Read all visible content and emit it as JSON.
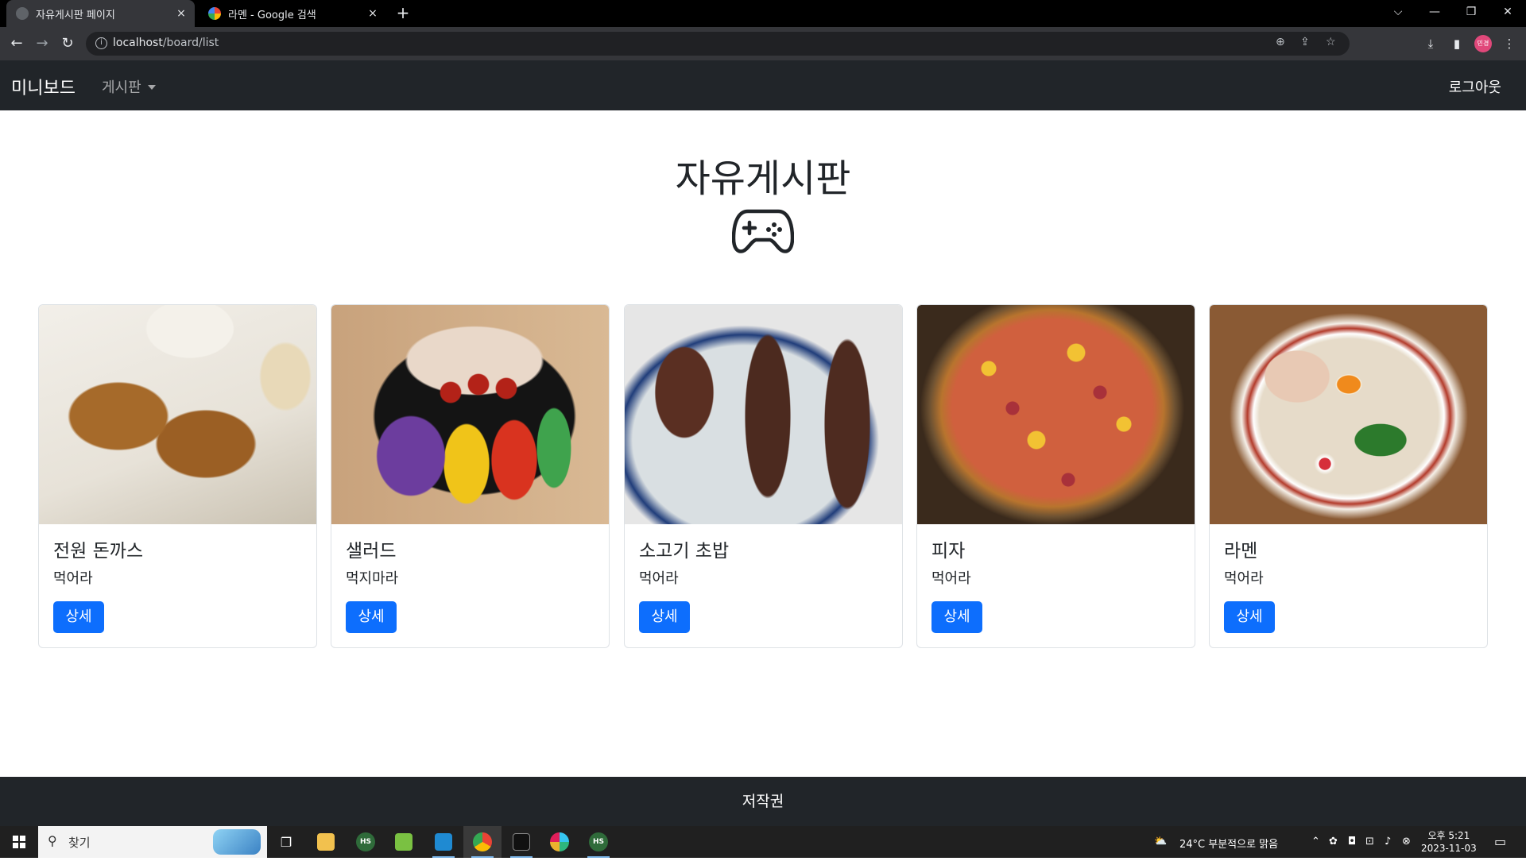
{
  "browser": {
    "tabs": [
      {
        "title": "자유게시판 페이지",
        "active": true,
        "close": "×"
      },
      {
        "title": "라멘 - Google 검색",
        "active": false,
        "close": "×"
      }
    ],
    "new_tab": "+",
    "url_host": "localhost",
    "url_path": "/board/list",
    "window_controls": {
      "dropdown": "⌵",
      "minimize": "—",
      "restore": "❐",
      "close": "✕"
    },
    "profile_label": "민경"
  },
  "navbar": {
    "brand": "미니보드",
    "menu_label": "게시판",
    "logout": "로그아웃"
  },
  "page": {
    "title": "자유게시판",
    "icon": "gamepad-icon"
  },
  "cards": [
    {
      "title": "전원 돈까스",
      "text": "먹어라",
      "button": "상세",
      "image": "pork-cutlet-photo"
    },
    {
      "title": "샐러드",
      "text": "먹지마라",
      "button": "상세",
      "image": "salad-photo"
    },
    {
      "title": "소고기 초밥",
      "text": "먹어라",
      "button": "상세",
      "image": "beef-sushi-photo"
    },
    {
      "title": "피자",
      "text": "먹어라",
      "button": "상세",
      "image": "pizza-photo"
    },
    {
      "title": "라멘",
      "text": "먹어라",
      "button": "상세",
      "image": "ramen-photo"
    }
  ],
  "footer": {
    "text": "저작권"
  },
  "taskbar": {
    "search_placeholder": "찾기",
    "weather": "24°C  부분적으로 맑음",
    "time": "오후 5:21",
    "date": "2023-11-03",
    "hs_label": "HS"
  },
  "colors": {
    "navbar_bg": "#212529",
    "primary_button": "#0d6efd",
    "chrome_bg": "#35363a"
  }
}
